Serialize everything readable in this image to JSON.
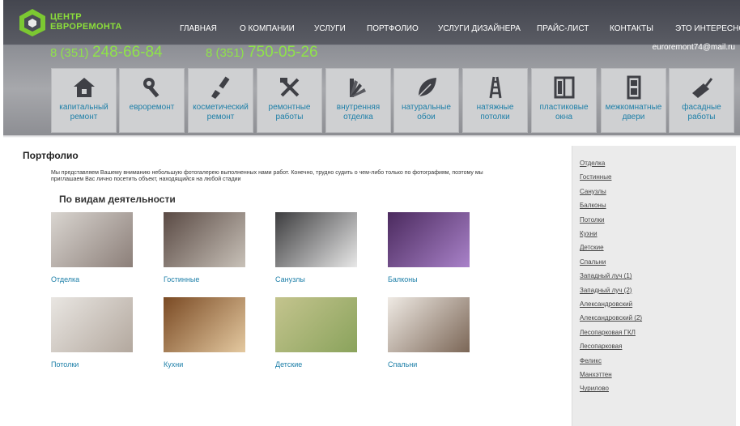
{
  "brand": {
    "line1": "ЦЕНТР",
    "line2": "ЕВРОРЕМОНТА"
  },
  "nav": [
    {
      "label": "ГЛАВНАЯ"
    },
    {
      "label": "О КОМПАНИИ"
    },
    {
      "label": "УСЛУГИ"
    },
    {
      "label": "ПОРТФОЛИО"
    },
    {
      "label": "УСЛУГИ ДИЗАЙНЕРА"
    },
    {
      "label": "ПРАЙС-ЛИСТ"
    },
    {
      "label": "КОНТАКТЫ"
    },
    {
      "label": "ЭТО ИНТЕРЕСНО"
    }
  ],
  "phones": [
    {
      "code": "8 (351)",
      "number": "248-66-84"
    },
    {
      "code": "8 (351)",
      "number": "750-05-26"
    }
  ],
  "email": "euroremont74@mail.ru",
  "services": [
    {
      "line1": "капитальный",
      "line2": "ремонт",
      "icon": "house-icon"
    },
    {
      "line1": "евроремонт",
      "line2": "",
      "icon": "wrench-tools-icon"
    },
    {
      "line1": "косметический",
      "line2": "ремонт",
      "icon": "paint-brush-icon"
    },
    {
      "line1": "ремонтные",
      "line2": "работы",
      "icon": "hammer-wrench-icon"
    },
    {
      "line1": "внутренняя",
      "line2": "отделка",
      "icon": "swatch-fan-icon"
    },
    {
      "line1": "натуральные",
      "line2": "обои",
      "icon": "leaf-icon"
    },
    {
      "line1": "натяжные",
      "line2": "потолки",
      "icon": "ladder-icon"
    },
    {
      "line1": "пластиковые",
      "line2": "окна",
      "icon": "window-icon"
    },
    {
      "line1": "межкомнатные",
      "line2": "двери",
      "icon": "door-icon"
    },
    {
      "line1": "фасадные",
      "line2": "работы",
      "icon": "trowel-icon"
    }
  ],
  "main": {
    "title": "Портфолио",
    "intro": "Мы представляем Вашему вниманию небольшую фотогалерею выполненных нами работ. Конечно, трудно судить о чем-либо только по фотографиям, поэтому мы приглашаем Вас лично посетить объект, находящийся на любой стадии",
    "subtitle": "По видам деятельности"
  },
  "gallery": [
    {
      "label": "Отделка",
      "colors": [
        "#d9d5d0",
        "#8c7f79"
      ]
    },
    {
      "label": "Гостинные",
      "colors": [
        "#5a4a44",
        "#c8c1b8"
      ]
    },
    {
      "label": "Санузлы",
      "colors": [
        "#3d3d3f",
        "#e8e8e8"
      ]
    },
    {
      "label": "Балконы",
      "colors": [
        "#4b2a5e",
        "#a982c9"
      ]
    },
    {
      "label": "Потолки",
      "colors": [
        "#e9e6e2",
        "#b3a89e"
      ]
    },
    {
      "label": "Кухни",
      "colors": [
        "#7a4a24",
        "#e4c9a0"
      ]
    },
    {
      "label": "Детские",
      "colors": [
        "#c4c48e",
        "#8aa35c"
      ]
    },
    {
      "label": "Спальни",
      "colors": [
        "#efeae4",
        "#7b6656"
      ]
    }
  ],
  "sidebar": [
    {
      "label": "Отделка"
    },
    {
      "label": "Гостинные"
    },
    {
      "label": "Санузлы"
    },
    {
      "label": "Балконы"
    },
    {
      "label": "Потолки"
    },
    {
      "label": "Кухни"
    },
    {
      "label": "Детские"
    },
    {
      "label": "Спальни"
    },
    {
      "label": "Западный луч (1)"
    },
    {
      "label": "Западный луч (2)"
    },
    {
      "label": "Александровский"
    },
    {
      "label": "Александровский (2)"
    },
    {
      "label": "Лесопарковая ГКЛ"
    },
    {
      "label": "Лесопарковая"
    },
    {
      "label": "Феликс"
    },
    {
      "label": "Манхэттен"
    },
    {
      "label": "Чурилово"
    }
  ],
  "colors": {
    "accent_green": "#8fe34a",
    "link_blue": "#1d7fa8",
    "tile_bg": "#cfd0d2",
    "header_dark": "#4a4c56"
  }
}
